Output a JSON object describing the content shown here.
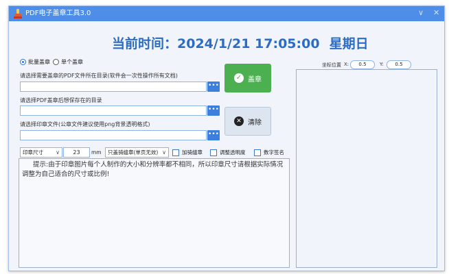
{
  "window": {
    "title": "PDF电子盖章工具3.0",
    "minimize": "∨",
    "close": "✕"
  },
  "clock": {
    "prefix": "当前时间：",
    "datetime": "2024/1/21 17:05:00",
    "weekday": "星期日"
  },
  "mode": {
    "options": [
      {
        "label": "批量盖章",
        "selected": true
      },
      {
        "label": "单个盖章",
        "selected": false
      }
    ]
  },
  "paths": {
    "pdf_dir_label": "请选择需要盖章的PDF文件所在目录(软件会一次性操作所有文档)",
    "pdf_dir_value": "",
    "output_dir_label": "请选择PDF盖章后想保存在的目录",
    "output_dir_value": "",
    "stamp_file_label": "请选择印章文件(公章文件建议使用png背景透明格式)",
    "stamp_file_value": "",
    "browse_glyph": "•••"
  },
  "actions": {
    "stamp_label": "盖章",
    "clear_label": "清除"
  },
  "options": {
    "size_select": "印章尺寸",
    "size_value": "23",
    "size_unit": "mm",
    "seam_select": "只盖骑缝章(单页无效)",
    "seam_label": "加骑缝章",
    "opacity_label": "调整透明度",
    "digital_sig_label": "数字签名"
  },
  "tip": "提示:由于印章图片每个人制作的大小和分辨率都不相同，所以印章尺寸请根据实际情况调整为自己适合的尺寸或比例!",
  "coords": {
    "label": "坐标位置",
    "x_label": "X:",
    "x_value": "0.5",
    "y_label": "Y:",
    "y_value": "0.5"
  },
  "colors": {
    "accent": "#4e8ee8",
    "stamp_button": "#4caf50",
    "clock_text": "#2b6cc4"
  }
}
